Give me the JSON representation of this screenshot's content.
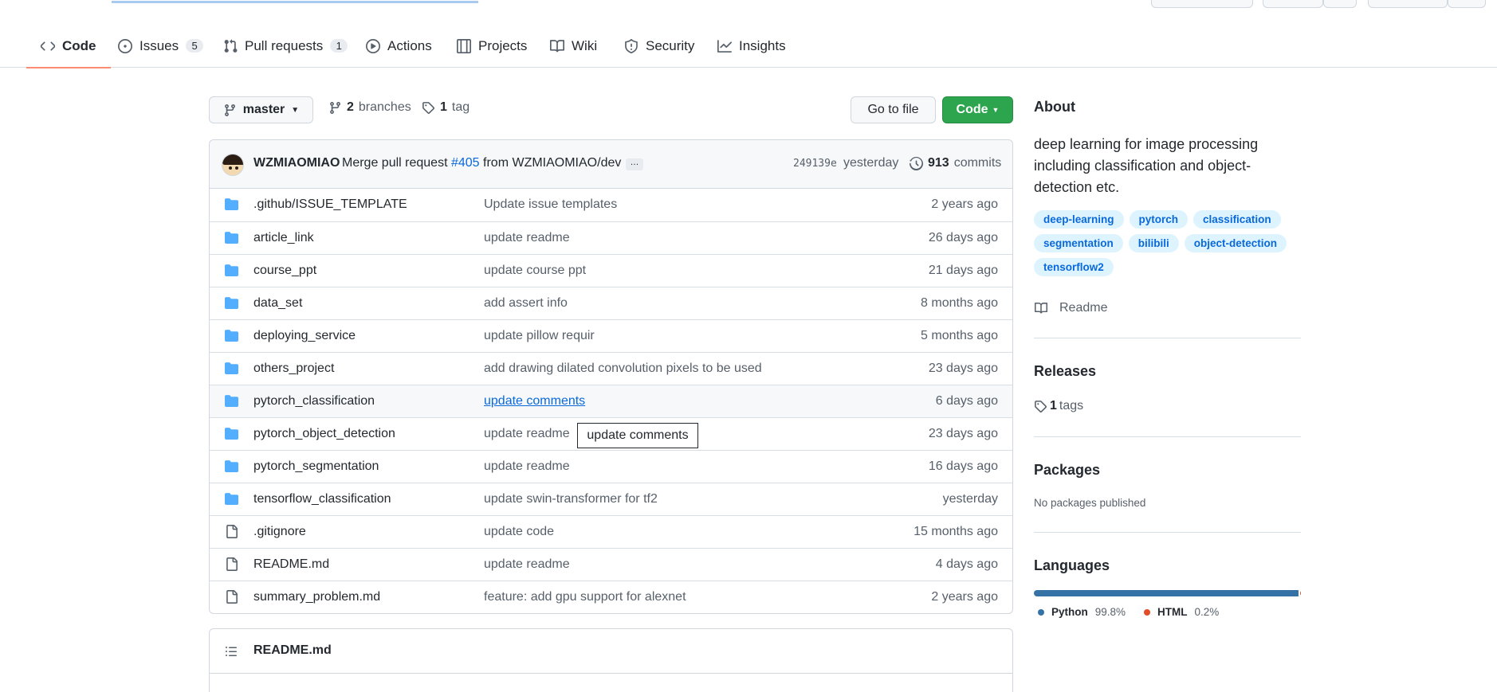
{
  "tabs": [
    {
      "label": "Code",
      "count": ""
    },
    {
      "label": "Issues",
      "count": "5"
    },
    {
      "label": "Pull requests",
      "count": "1"
    },
    {
      "label": "Actions",
      "count": ""
    },
    {
      "label": "Projects",
      "count": ""
    },
    {
      "label": "Wiki",
      "count": ""
    },
    {
      "label": "Security",
      "count": ""
    },
    {
      "label": "Insights",
      "count": ""
    }
  ],
  "toolbar": {
    "branch": "master",
    "branches_count": "2",
    "branches_label": "branches",
    "tags_count": "1",
    "tags_label": "tag",
    "go_to_file": "Go to file",
    "code_button": "Code"
  },
  "latest_commit": {
    "author": "WZMIAOMIAO",
    "message_prefix": "Merge pull request",
    "pr_number": "#405",
    "message_suffix": "from WZMIAOMIAO/dev",
    "ellipsis": "…",
    "sha": "249139e",
    "time": "yesterday",
    "commits_count": "913",
    "commits_label": "commits"
  },
  "files": [
    {
      "name": ".github/ISSUE_TEMPLATE",
      "message": "Update issue templates",
      "age": "2 years ago",
      "type": "dir"
    },
    {
      "name": "article_link",
      "message": "update readme",
      "age": "26 days ago",
      "type": "dir"
    },
    {
      "name": "course_ppt",
      "message": "update course ppt",
      "age": "21 days ago",
      "type": "dir"
    },
    {
      "name": "data_set",
      "message": "add assert info",
      "age": "8 months ago",
      "type": "dir"
    },
    {
      "name": "deploying_service",
      "message": "update pillow requir",
      "age": "5 months ago",
      "type": "dir"
    },
    {
      "name": "others_project",
      "message": "add drawing dilated convolution pixels to be used",
      "age": "23 days ago",
      "type": "dir"
    },
    {
      "name": "pytorch_classification",
      "message": "update comments",
      "age": "6 days ago",
      "type": "dir"
    },
    {
      "name": "pytorch_object_detection",
      "message": "update readme",
      "age": "23 days ago",
      "type": "dir"
    },
    {
      "name": "pytorch_segmentation",
      "message": "update readme",
      "age": "16 days ago",
      "type": "dir"
    },
    {
      "name": "tensorflow_classification",
      "message": "update swin-transformer for tf2",
      "age": "yesterday",
      "type": "dir"
    },
    {
      "name": ".gitignore",
      "message": "update code",
      "age": "15 months ago",
      "type": "file"
    },
    {
      "name": "README.md",
      "message": "update readme",
      "age": "4 days ago",
      "type": "file"
    },
    {
      "name": "summary_problem.md",
      "message": "feature: add gpu support for alexnet",
      "age": "2 years ago",
      "type": "file"
    }
  ],
  "tooltip": "update comments",
  "readme_header": "README.md",
  "sidebar": {
    "about_title": "About",
    "description": "deep learning for image processing including classification and object-detection etc.",
    "topics": [
      "deep-learning",
      "pytorch",
      "classification",
      "segmentation",
      "bilibili",
      "object-detection",
      "tensorflow2"
    ],
    "readme_label": "Readme",
    "releases_title": "Releases",
    "tags_count": "1",
    "tags_label": "tags",
    "packages_title": "Packages",
    "packages_empty": "No packages published",
    "languages_title": "Languages",
    "languages": [
      {
        "name": "Python",
        "percent": "99.8%",
        "fraction": 0.998,
        "color": "#3572A5"
      },
      {
        "name": "HTML",
        "percent": "0.2%",
        "fraction": 0.002,
        "color": "#e34c26"
      }
    ]
  },
  "colors": {
    "accent": "#0969da",
    "green": "#2da44e",
    "tab_underline": "#fd8c73",
    "folder": "#54aeff"
  }
}
